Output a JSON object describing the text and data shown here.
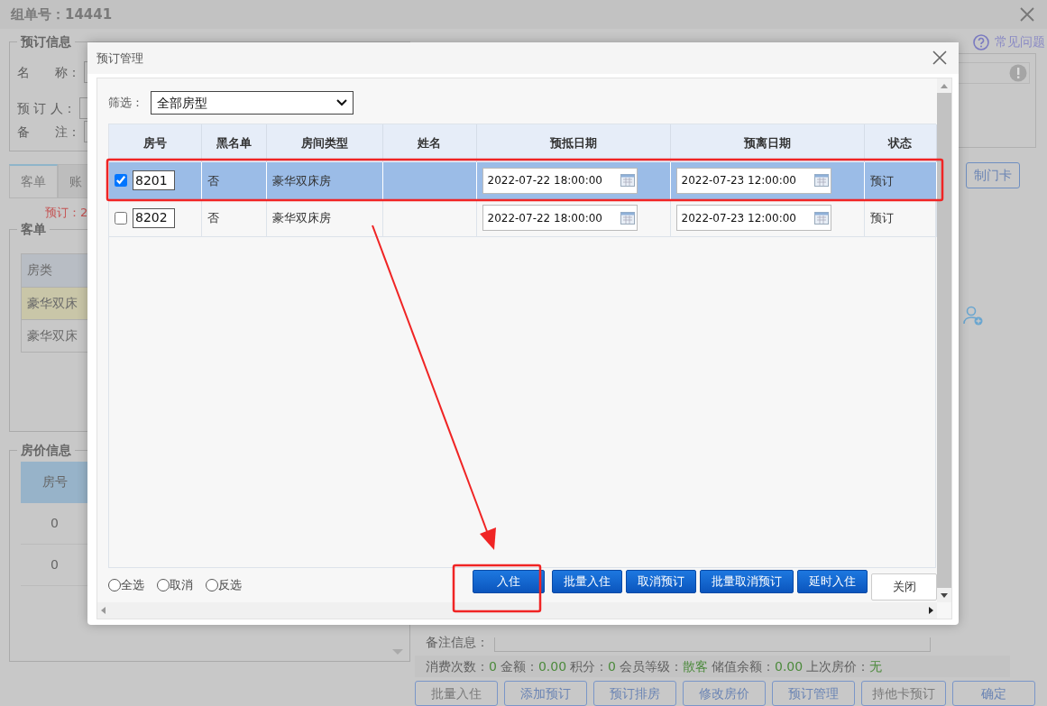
{
  "window": {
    "title": "组单号：14441"
  },
  "help_link": "常见问题",
  "booking_info": {
    "legend": "预订信息",
    "fields": [
      {
        "label": "名　　称："
      },
      {
        "label": "预 订 人："
      },
      {
        "label": "备　　注："
      }
    ]
  },
  "tabs": [
    {
      "label": "客单",
      "selected": true
    },
    {
      "label": "账",
      "selected": false
    }
  ],
  "booking_count": "预订：2",
  "guest_list": {
    "legend": "客单",
    "header": "房类",
    "rows": [
      {
        "text": "豪华双床",
        "selected": true
      },
      {
        "text": "豪华双床",
        "selected": false
      }
    ]
  },
  "price_info": {
    "legend": "房价信息",
    "header": "房号",
    "rows": [
      "0",
      "0"
    ]
  },
  "side_buttons": [
    "制门卡"
  ],
  "remark_label": "备注信息：",
  "stats": [
    {
      "label": "消费次数：",
      "value": "0"
    },
    {
      "label": "金额：",
      "value": "0.00"
    },
    {
      "label": "积分：",
      "value": "0"
    },
    {
      "label": "会员等级：",
      "value": "散客"
    },
    {
      "label": "储值余额：",
      "value": "0.00"
    },
    {
      "label": "上次房价：",
      "value": "无"
    }
  ],
  "actions": [
    "批量入住",
    "添加预订",
    "预订排房",
    "修改房价",
    "预订管理",
    "持他卡预订",
    "确定"
  ],
  "dialog": {
    "title": "预订管理",
    "filter_label": "筛选：",
    "filter_value": "全部房型",
    "columns": [
      "房号",
      "黑名单",
      "房间类型",
      "姓名",
      "预抵日期",
      "预离日期",
      "状态"
    ],
    "rows": [
      {
        "checked": true,
        "selected": true,
        "room": "8201",
        "blacklist": "否",
        "room_type": "豪华双床房",
        "arrival": "2022-07-22 18:00:00",
        "departure": "2022-07-23 12:00:00",
        "status": "预订"
      },
      {
        "checked": false,
        "selected": false,
        "room": "8202",
        "blacklist": "否",
        "room_type": "豪华双床房",
        "arrival": "2022-07-22 18:00:00",
        "departure": "2022-07-23 12:00:00",
        "status": "预订"
      }
    ],
    "radios": [
      {
        "label": "全选",
        "selected": false
      },
      {
        "label": "取消",
        "selected": false
      },
      {
        "label": "反选",
        "selected": false
      }
    ],
    "buttons": [
      {
        "label": "入住",
        "kind": "primary"
      },
      {
        "label": "批量入住",
        "kind": "primary"
      },
      {
        "label": "取消预订",
        "kind": "primary"
      },
      {
        "label": "批量取消预订",
        "kind": "primary"
      },
      {
        "label": "延时入住",
        "kind": "primary"
      },
      {
        "label": "关闭",
        "kind": "plain"
      }
    ]
  }
}
